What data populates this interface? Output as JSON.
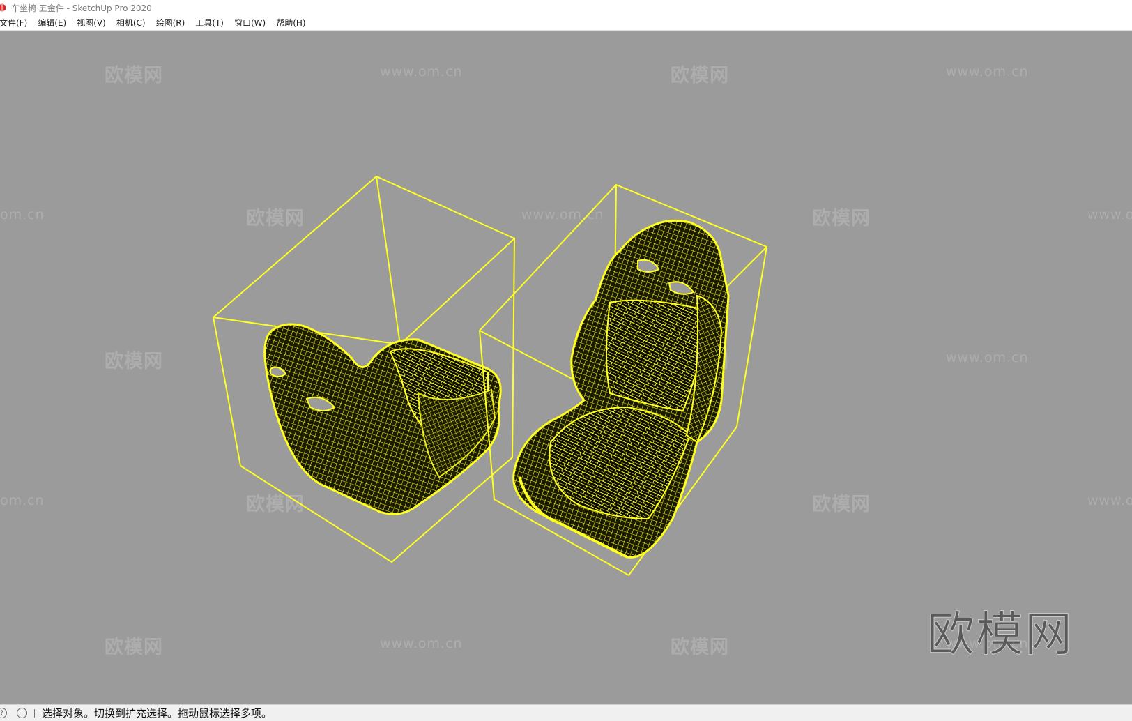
{
  "window": {
    "title": "车坐椅 五金件 - SketchUp Pro 2020",
    "app_icon": "sketchup-icon",
    "accent_color": "#d62b2b"
  },
  "menu": {
    "items": [
      "文件(F)",
      "编辑(E)",
      "视图(V)",
      "相机(C)",
      "绘图(R)",
      "工具(T)",
      "窗口(W)",
      "帮助(H)"
    ]
  },
  "viewport": {
    "background": "#9b9b9b",
    "selection_color": "#ffff22",
    "watermarks": {
      "brand": "欧模网",
      "url": "www.om.cn",
      "url_partial": "om.cn",
      "big_logo": "欧模网"
    }
  },
  "status": {
    "icons": [
      "geo-location-icon",
      "info-icon"
    ],
    "message": "选择对象。切换到扩充选择。拖动鼠标选择多项。"
  }
}
